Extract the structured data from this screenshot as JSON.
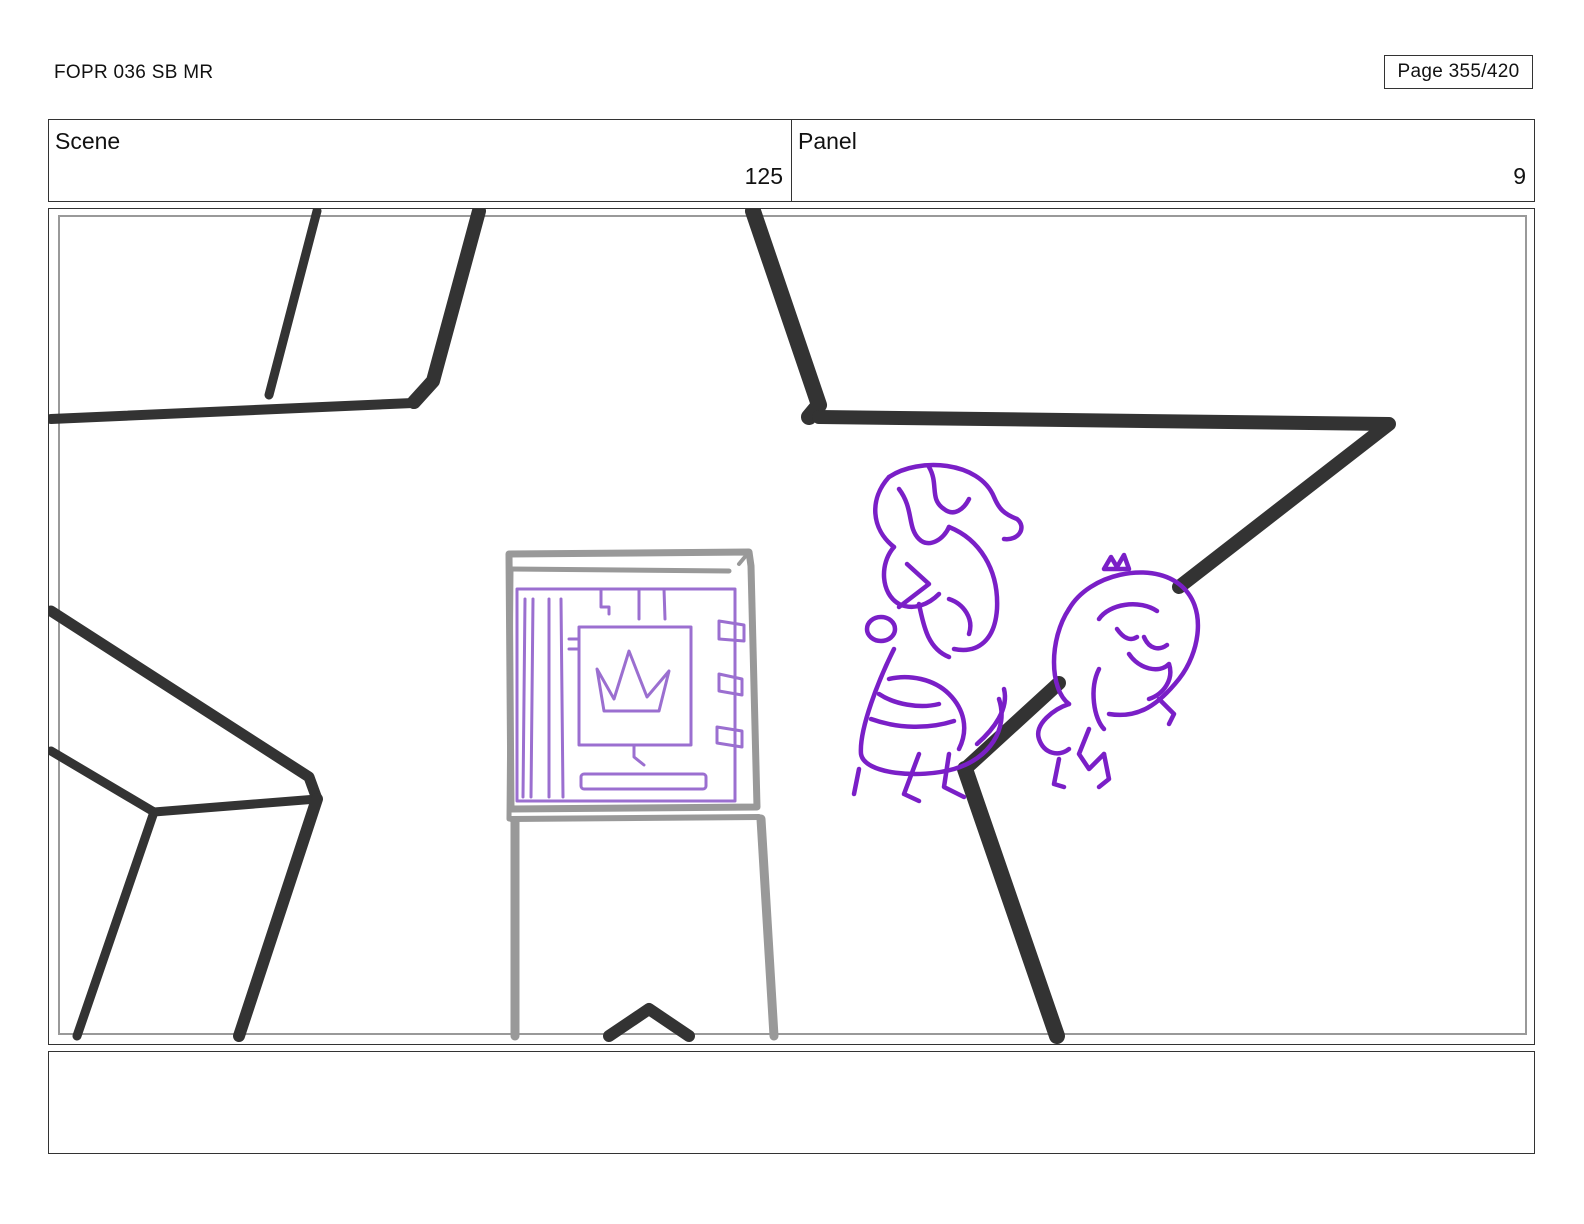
{
  "document": {
    "title": "FOPR 036 SB MR",
    "page_label": "Page 355/420"
  },
  "scene": {
    "label": "Scene",
    "value": "125"
  },
  "panel": {
    "label": "Panel",
    "value": "9"
  },
  "notes": {
    "text": ""
  },
  "colors": {
    "ink": "#333333",
    "frame": "#999999",
    "sketch_purple": "#7a1fc7",
    "sketch_lavender": "#9b6fd0"
  },
  "artwork": {
    "description_icons": [
      "star-floor-outline",
      "display-case",
      "crown-icon",
      "character-sketch-left",
      "character-sketch-right"
    ]
  }
}
